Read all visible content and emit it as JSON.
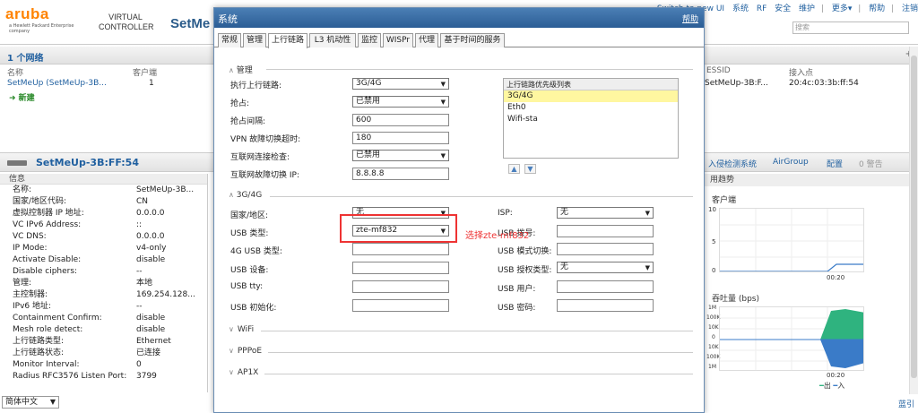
{
  "header": {
    "brand": "aruba",
    "brand_sub": "a Hewlett Packard Enterprise company",
    "virtual_controller": "VIRTUAL CONTROLLER",
    "title": "SetMe",
    "top_links": [
      "Switch to new UI",
      "系统",
      "RF",
      "安全",
      "维护",
      "更多▾",
      "帮助",
      "注销"
    ],
    "search_placeholder": "搜索"
  },
  "networks": {
    "title": "1 个网络",
    "col_name": "名称",
    "col_clients": "客户端",
    "row_name": "SetMeUp (SetMeUp-3B...",
    "row_clients": "1",
    "new_label": "➜ 新建",
    "col_essid": "ESSID",
    "col_ap": "接入点",
    "essid_val": "SetMeUp-3B:F...",
    "ap_val": "20:4c:03:3b:ff:54"
  },
  "device": {
    "name": "SetMeUp-3B:FF:54",
    "links": [
      "入侵检测系统",
      "AirGroup",
      "配置",
      "0 警告"
    ]
  },
  "info": {
    "header": "信息",
    "rows": [
      {
        "k": "名称:",
        "v": "SetMeUp-3B..."
      },
      {
        "k": "国家/地区代码:",
        "v": "CN"
      },
      {
        "k": "虚拟控制器 IP 地址:",
        "v": "0.0.0.0"
      },
      {
        "k": "VC IPv6 Address:",
        "v": "::"
      },
      {
        "k": "VC DNS:",
        "v": "0.0.0.0"
      },
      {
        "k": "IP Mode:",
        "v": "v4-only"
      },
      {
        "k": "Activate Disable:",
        "v": "disable"
      },
      {
        "k": "Disable ciphers:",
        "v": "--"
      },
      {
        "k": "管理:",
        "v": "本地"
      },
      {
        "k": "主控制器:",
        "v": "169.254.128..."
      },
      {
        "k": "IPv6 地址:",
        "v": "--"
      },
      {
        "k": "Containment Confirm:",
        "v": "disable"
      },
      {
        "k": "Mesh role detect:",
        "v": "disable"
      },
      {
        "k": "上行链路类型:",
        "v": "Ethernet"
      },
      {
        "k": "上行链路状态:",
        "v": "已连接"
      },
      {
        "k": "Monitor Interval:",
        "v": "0"
      },
      {
        "k": "Radius RFC3576 Listen Port:",
        "v": "3799"
      }
    ]
  },
  "language": "简体中文",
  "bottom_right": "蓝引",
  "trends": {
    "header": "用趋势",
    "clients_title": "客户端",
    "clients_y": [
      "10",
      "5",
      "0"
    ],
    "clients_x": "00:20",
    "throughput_title": "吞吐量 (bps)",
    "throughput_y": [
      "1M",
      "100K",
      "10K",
      "0",
      "10K",
      "100K",
      "1M"
    ],
    "throughput_x": "00:20",
    "legend_out": "出",
    "legend_in": "入"
  },
  "dialog": {
    "title": "系统",
    "help": "帮助",
    "tabs": [
      "常规",
      "管理",
      "上行链路",
      "L3 机动性",
      "监控",
      "WISPr",
      "代理",
      "基于时间的服务"
    ],
    "active_tab": 2,
    "mgmt_section": "管理",
    "uplink_label": "执行上行链路:",
    "uplink_value": "3G/4G",
    "preempt_label": "抢占:",
    "preempt_value": "已禁用",
    "preempt_interval_label": "抢占间隔:",
    "preempt_interval_value": "600",
    "vpn_label": "VPN 故障切换超时:",
    "vpn_value": "180",
    "internet_check_label": "互联网连接检查:",
    "internet_check_value": "已禁用",
    "failover_ip_label": "互联网故障切换 IP:",
    "failover_ip_value": "8.8.8.8",
    "priority_title": "上行链路优先级列表",
    "priority_items": [
      "3G/4G",
      "Eth0",
      "Wifi-sta"
    ],
    "section_3g": "3G/4G",
    "country_label": "国家/地区:",
    "country_value": "无",
    "usb_type_label": "USB 类型:",
    "usb_type_value": "zte-mf832",
    "usb4g_label": "4G USB 类型:",
    "usb_device_label": "USB 设备:",
    "usb_tty_label": "USB tty:",
    "usb_init_label": "USB 初始化:",
    "isp_label": "ISP:",
    "isp_value": "无",
    "usb_dial_label": "USB 拨号:",
    "usb_mode_label": "USB 模式切换:",
    "usb_auth_label": "USB 授权类型:",
    "usb_auth_value": "无",
    "usb_user_label": "USB 用户:",
    "usb_pass_label": "USB 密码:",
    "annotation": "选择zte-mf832",
    "collapsed_sections": [
      "WiFi",
      "PPPoE",
      "AP1X"
    ]
  }
}
